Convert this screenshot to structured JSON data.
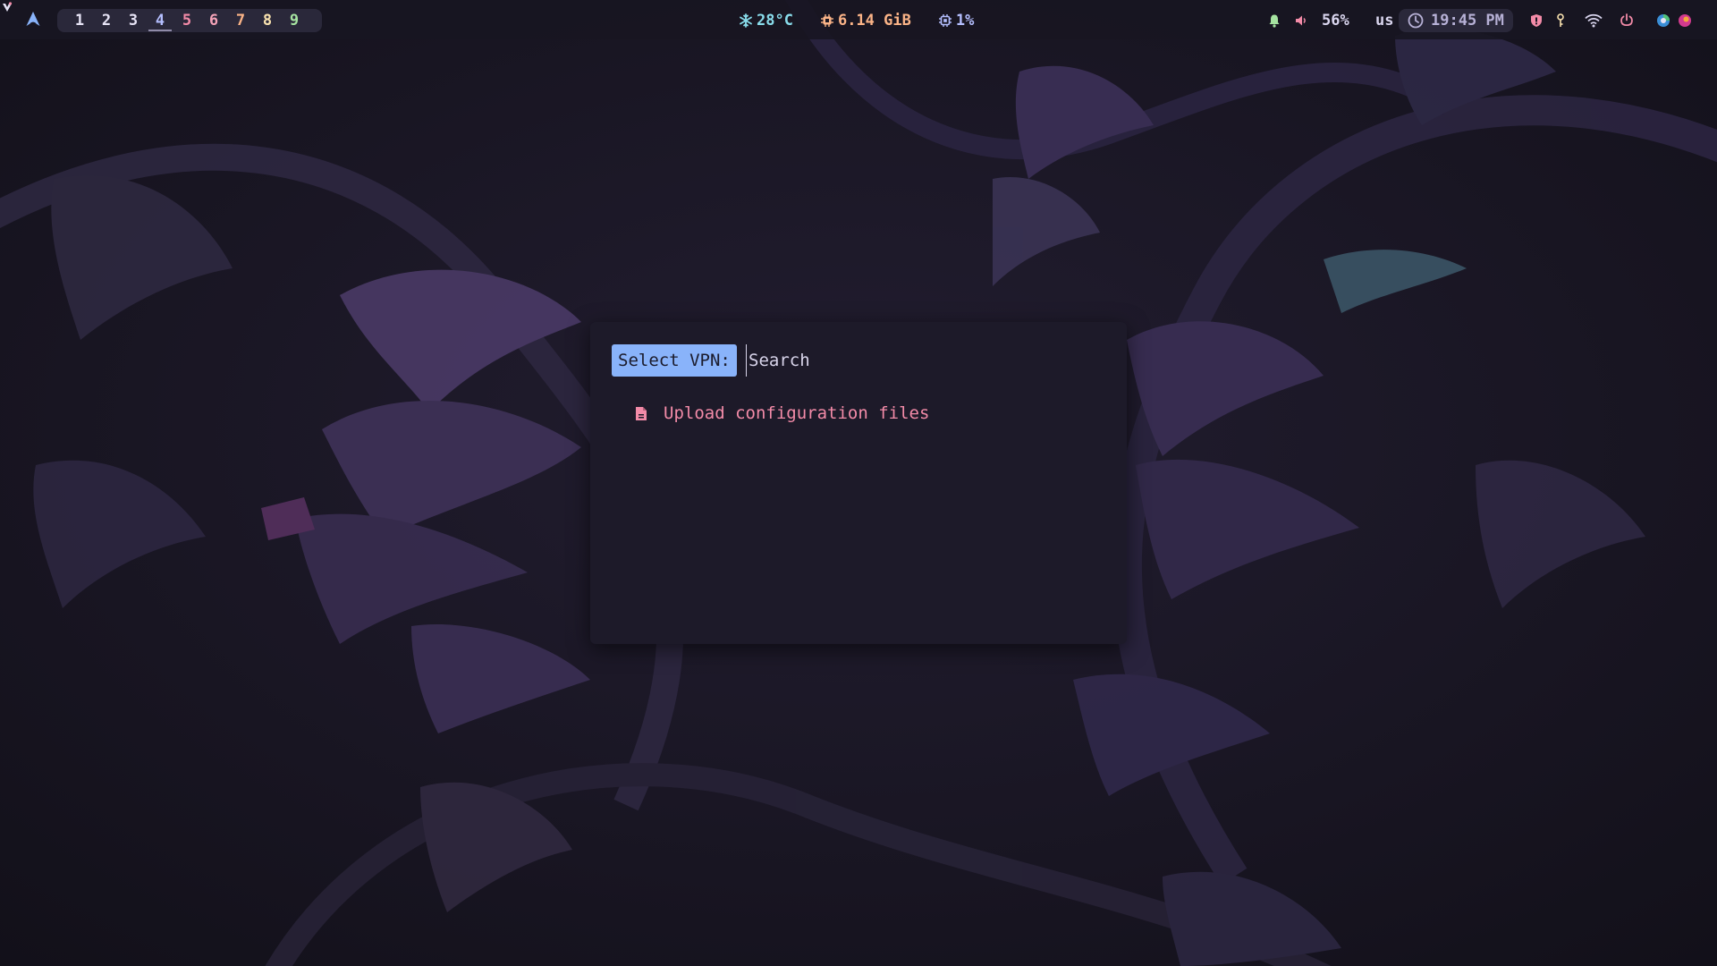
{
  "colors": {
    "accent": "#89b3fa",
    "entry_text": "#f38ba8",
    "temp": "#89dceb",
    "memory": "#fab387",
    "cpu": "#b4befe",
    "dialog_bg": "#1d1a29",
    "bar_bg": "#181622"
  },
  "topbar": {
    "launcher_icon": "arch-logo-icon",
    "workspaces": [
      {
        "label": "1",
        "color": "#e6e3f5",
        "active": false
      },
      {
        "label": "2",
        "color": "#e6e3f5",
        "active": false
      },
      {
        "label": "3",
        "color": "#e6e3f5",
        "active": false
      },
      {
        "label": "4",
        "color": "#b4befe",
        "active": true
      },
      {
        "label": "5",
        "color": "#f38ba8",
        "active": false
      },
      {
        "label": "6",
        "color": "#f5a3b8",
        "active": false
      },
      {
        "label": "7",
        "color": "#fab387",
        "active": false
      },
      {
        "label": "8",
        "color": "#f9e2af",
        "active": false
      },
      {
        "label": "9",
        "color": "#a6e3a1",
        "active": false
      }
    ],
    "stats": {
      "temperature": "28°C",
      "memory": "6.14 GiB",
      "cpu": "1%"
    },
    "status": {
      "volume": "56%",
      "keyboard_layout": "us",
      "clock": "19:45 PM"
    }
  },
  "dialog": {
    "prompt": "Select VPN:",
    "search_placeholder": "Search",
    "entries": [
      {
        "label": "Upload configuration files",
        "icon": "file-icon"
      }
    ]
  }
}
